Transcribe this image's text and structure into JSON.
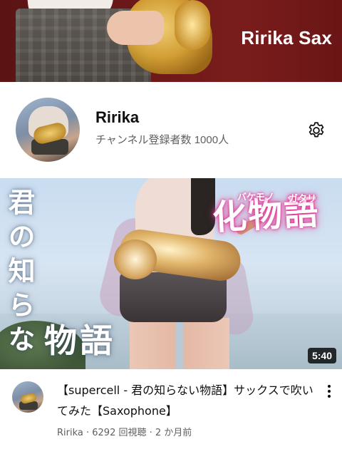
{
  "banner": {
    "title": "Ririka Sax"
  },
  "channel": {
    "name": "Ririka",
    "subscribers": "チャンネル登録者数 1000人"
  },
  "video": {
    "thumbnail": {
      "vertical_text": "君の知らない",
      "monogatari": "物語",
      "bakemonogatari": "化物語",
      "ruby_left": "バケモノ",
      "ruby_right": "ガタリ"
    },
    "duration": "5:40",
    "title": "【supercell - 君の知らない物語】サックスで吹いてみた【Saxophone】",
    "subtitle": "Ririka · 6292 回視聴 · 2 か月前"
  },
  "icons": {
    "settings": "gear-icon",
    "more": "more-vert-icon"
  }
}
